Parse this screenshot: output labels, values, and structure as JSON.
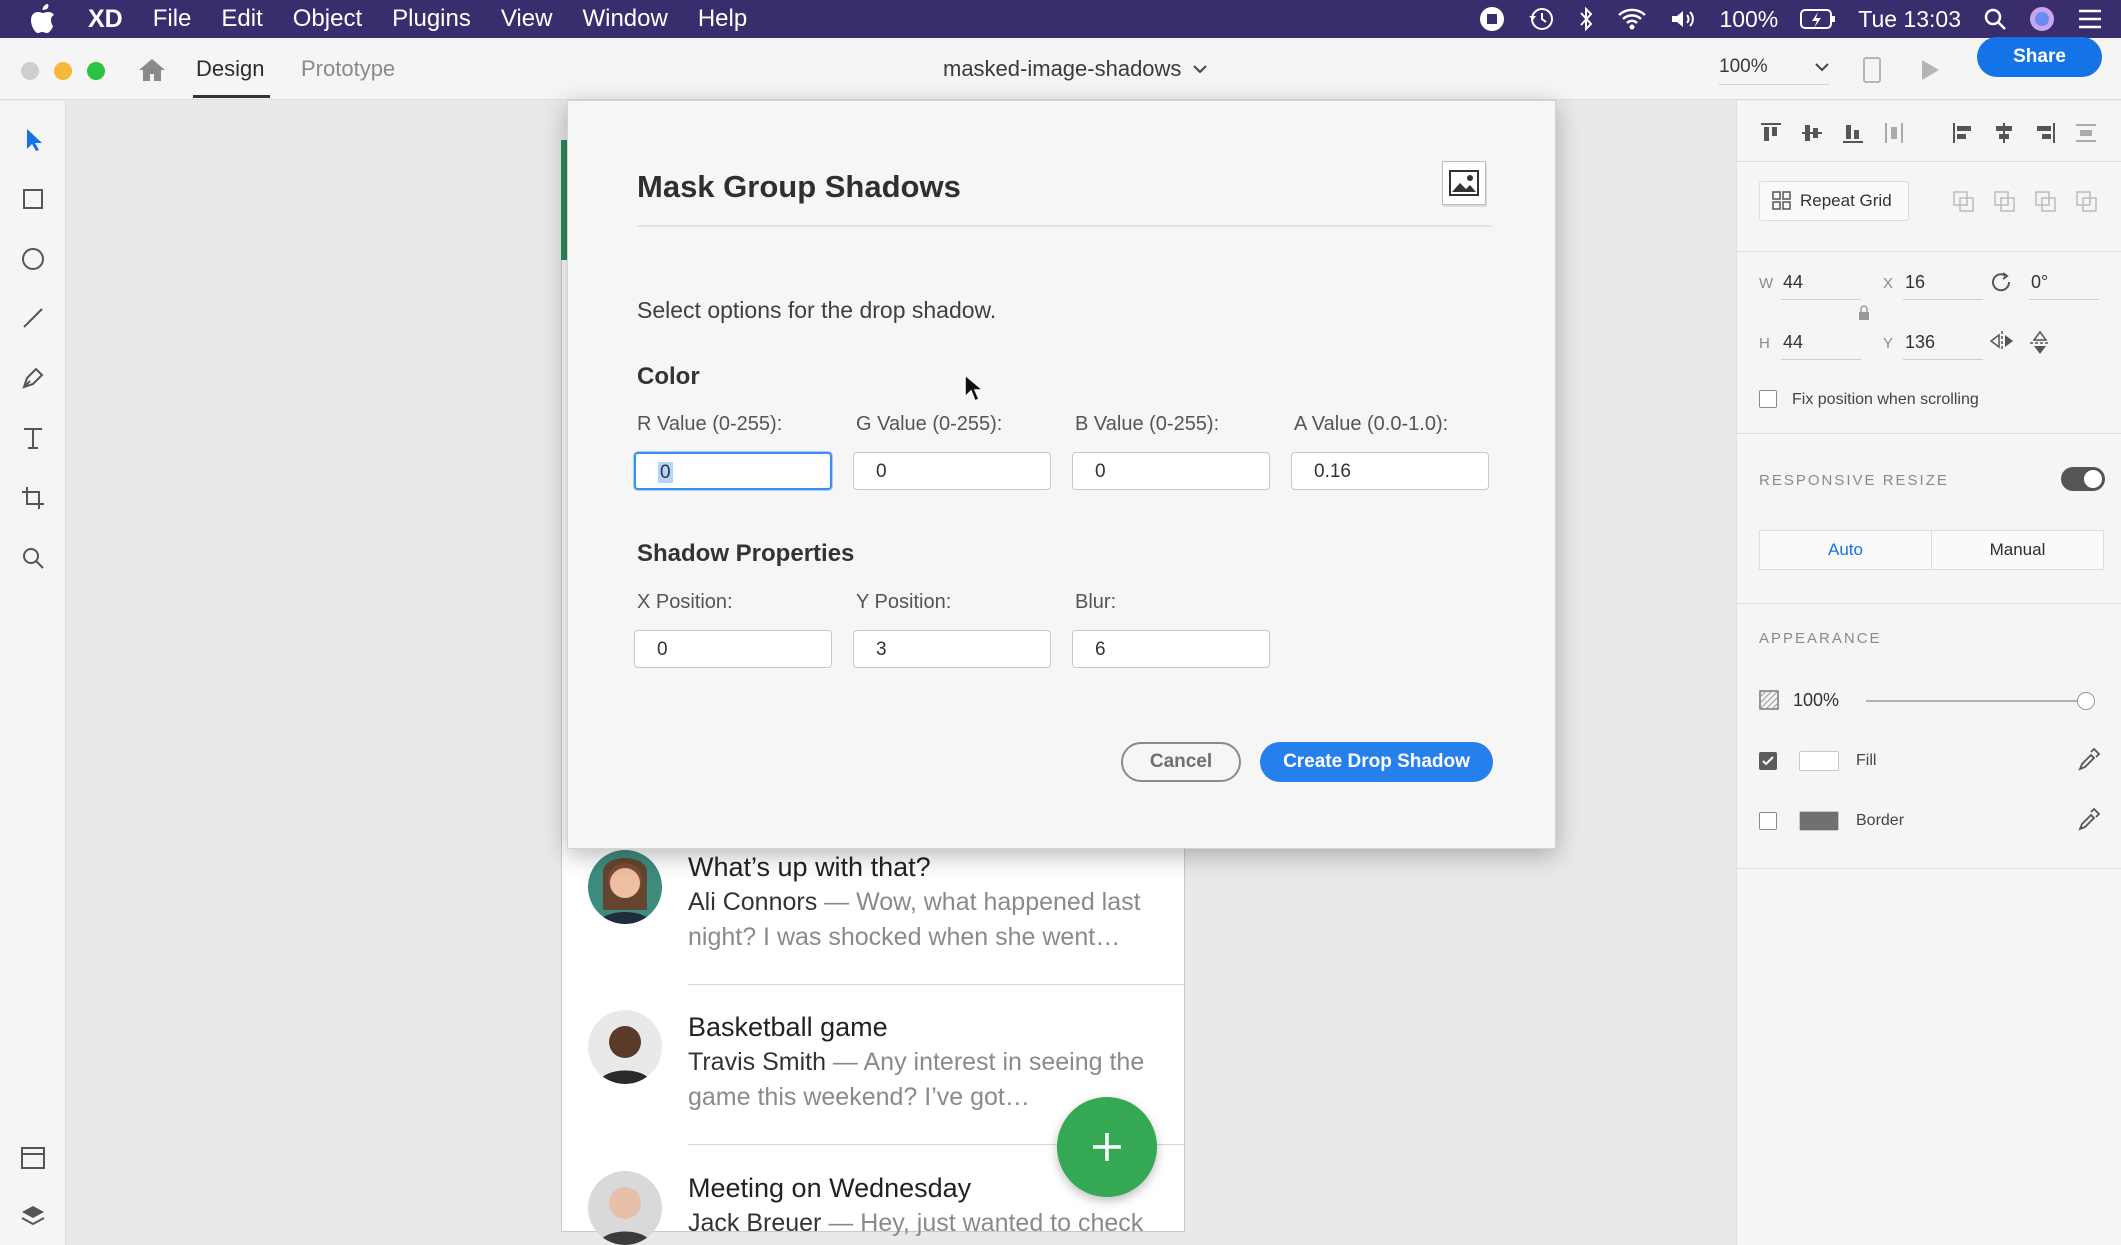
{
  "menubar": {
    "app_name": "XD",
    "items": [
      "File",
      "Edit",
      "Object",
      "Plugins",
      "View",
      "Window",
      "Help"
    ],
    "battery": "100%",
    "clock": "Tue 13:03"
  },
  "titlebar": {
    "tabs": [
      "Design",
      "Prototype"
    ],
    "active_tab": "Design",
    "document_name": "masked-image-shadows",
    "zoom": "100%",
    "share_label": "Share"
  },
  "dialog": {
    "title": "Mask Group Shadows",
    "description": "Select options for the drop shadow.",
    "color_section": "Color",
    "shadow_section": "Shadow Properties",
    "color_fields": [
      {
        "label": "R Value (0-255):",
        "value": "0"
      },
      {
        "label": "G Value (0-255):",
        "value": "0"
      },
      {
        "label": "B Value (0-255):",
        "value": "0"
      },
      {
        "label": "A Value (0.0-1.0):",
        "value": "0.16"
      }
    ],
    "shadow_fields": [
      {
        "label": "X Position:",
        "value": "0"
      },
      {
        "label": "Y Position:",
        "value": "3"
      },
      {
        "label": "Blur:",
        "value": "6"
      }
    ],
    "cancel_label": "Cancel",
    "primary_label": "Create Drop Shadow"
  },
  "messages": [
    {
      "title": "What’s up with that?",
      "sender": "Ali Connors",
      "preview1": " — Wow, what happened last",
      "preview2": "night? I was shocked when she went…"
    },
    {
      "title": "Basketball game",
      "sender": "Travis Smith",
      "preview1": " — Any interest in seeing the",
      "preview2": "game this weekend? I’ve got…"
    },
    {
      "title": "Meeting on Wednesday",
      "sender": "Jack Breuer",
      "preview1": " — Hey, just wanted to check",
      "preview2": ""
    }
  ],
  "fab_label": "+",
  "panel": {
    "repeat_grid_label": "Repeat Grid",
    "w_label": "W",
    "w_value": "44",
    "h_label": "H",
    "h_value": "44",
    "x_label": "X",
    "x_value": "16",
    "y_label": "Y",
    "y_value": "136",
    "rotation": "0°",
    "fix_position_label": "Fix position when scrolling",
    "responsive_resize_label": "RESPONSIVE RESIZE",
    "resize_modes": [
      "Auto",
      "Manual"
    ],
    "appearance_label": "APPEARANCE",
    "opacity": "100%",
    "fill_label": "Fill",
    "border_label": "Border",
    "fill_color": "#ffffff",
    "border_color": "#707070"
  },
  "colors": {
    "accent": "#1473e6",
    "primary_button": "#2680eb",
    "fab": "#35a853",
    "menubar": "#3a2d6e"
  }
}
